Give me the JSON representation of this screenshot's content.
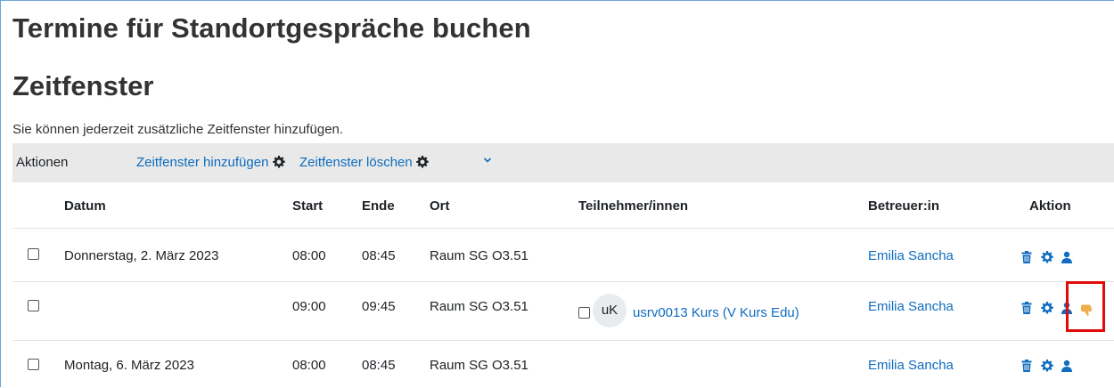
{
  "page": {
    "title": "Termine für Standortgespräche buchen",
    "section_title": "Zeitfenster",
    "intro": "Sie können jederzeit zusätzliche Zeitfenster hinzufügen."
  },
  "actions": {
    "label": "Aktionen",
    "add_slots": "Zeitfenster hinzufügen",
    "delete_slots": "Zeitfenster löschen"
  },
  "table": {
    "headers": {
      "date": "Datum",
      "start": "Start",
      "end": "Ende",
      "location": "Ort",
      "participants": "Teilnehmer/innen",
      "supervisor": "Betreuer:in",
      "action": "Aktion"
    },
    "rows": [
      {
        "date": "Donnerstag, 2. März 2023",
        "start": "08:00",
        "end": "08:45",
        "location": "Raum SG O3.51",
        "participant": "",
        "supervisor": "Emilia Sancha"
      },
      {
        "date": "",
        "start": "09:00",
        "end": "09:45",
        "location": "Raum SG O3.51",
        "participant_initials": "uK",
        "participant": "usrv0013 Kurs (V Kurs Edu)",
        "supervisor": "Emilia Sancha"
      },
      {
        "date": "Montag, 6. März 2023",
        "start": "08:00",
        "end": "08:45",
        "location": "Raum SG O3.51",
        "participant": "",
        "supervisor": "Emilia Sancha"
      }
    ]
  },
  "colors": {
    "link": "#0f6cbf",
    "highlight": "#e20a0a",
    "thumb": "#f0ad4e"
  }
}
